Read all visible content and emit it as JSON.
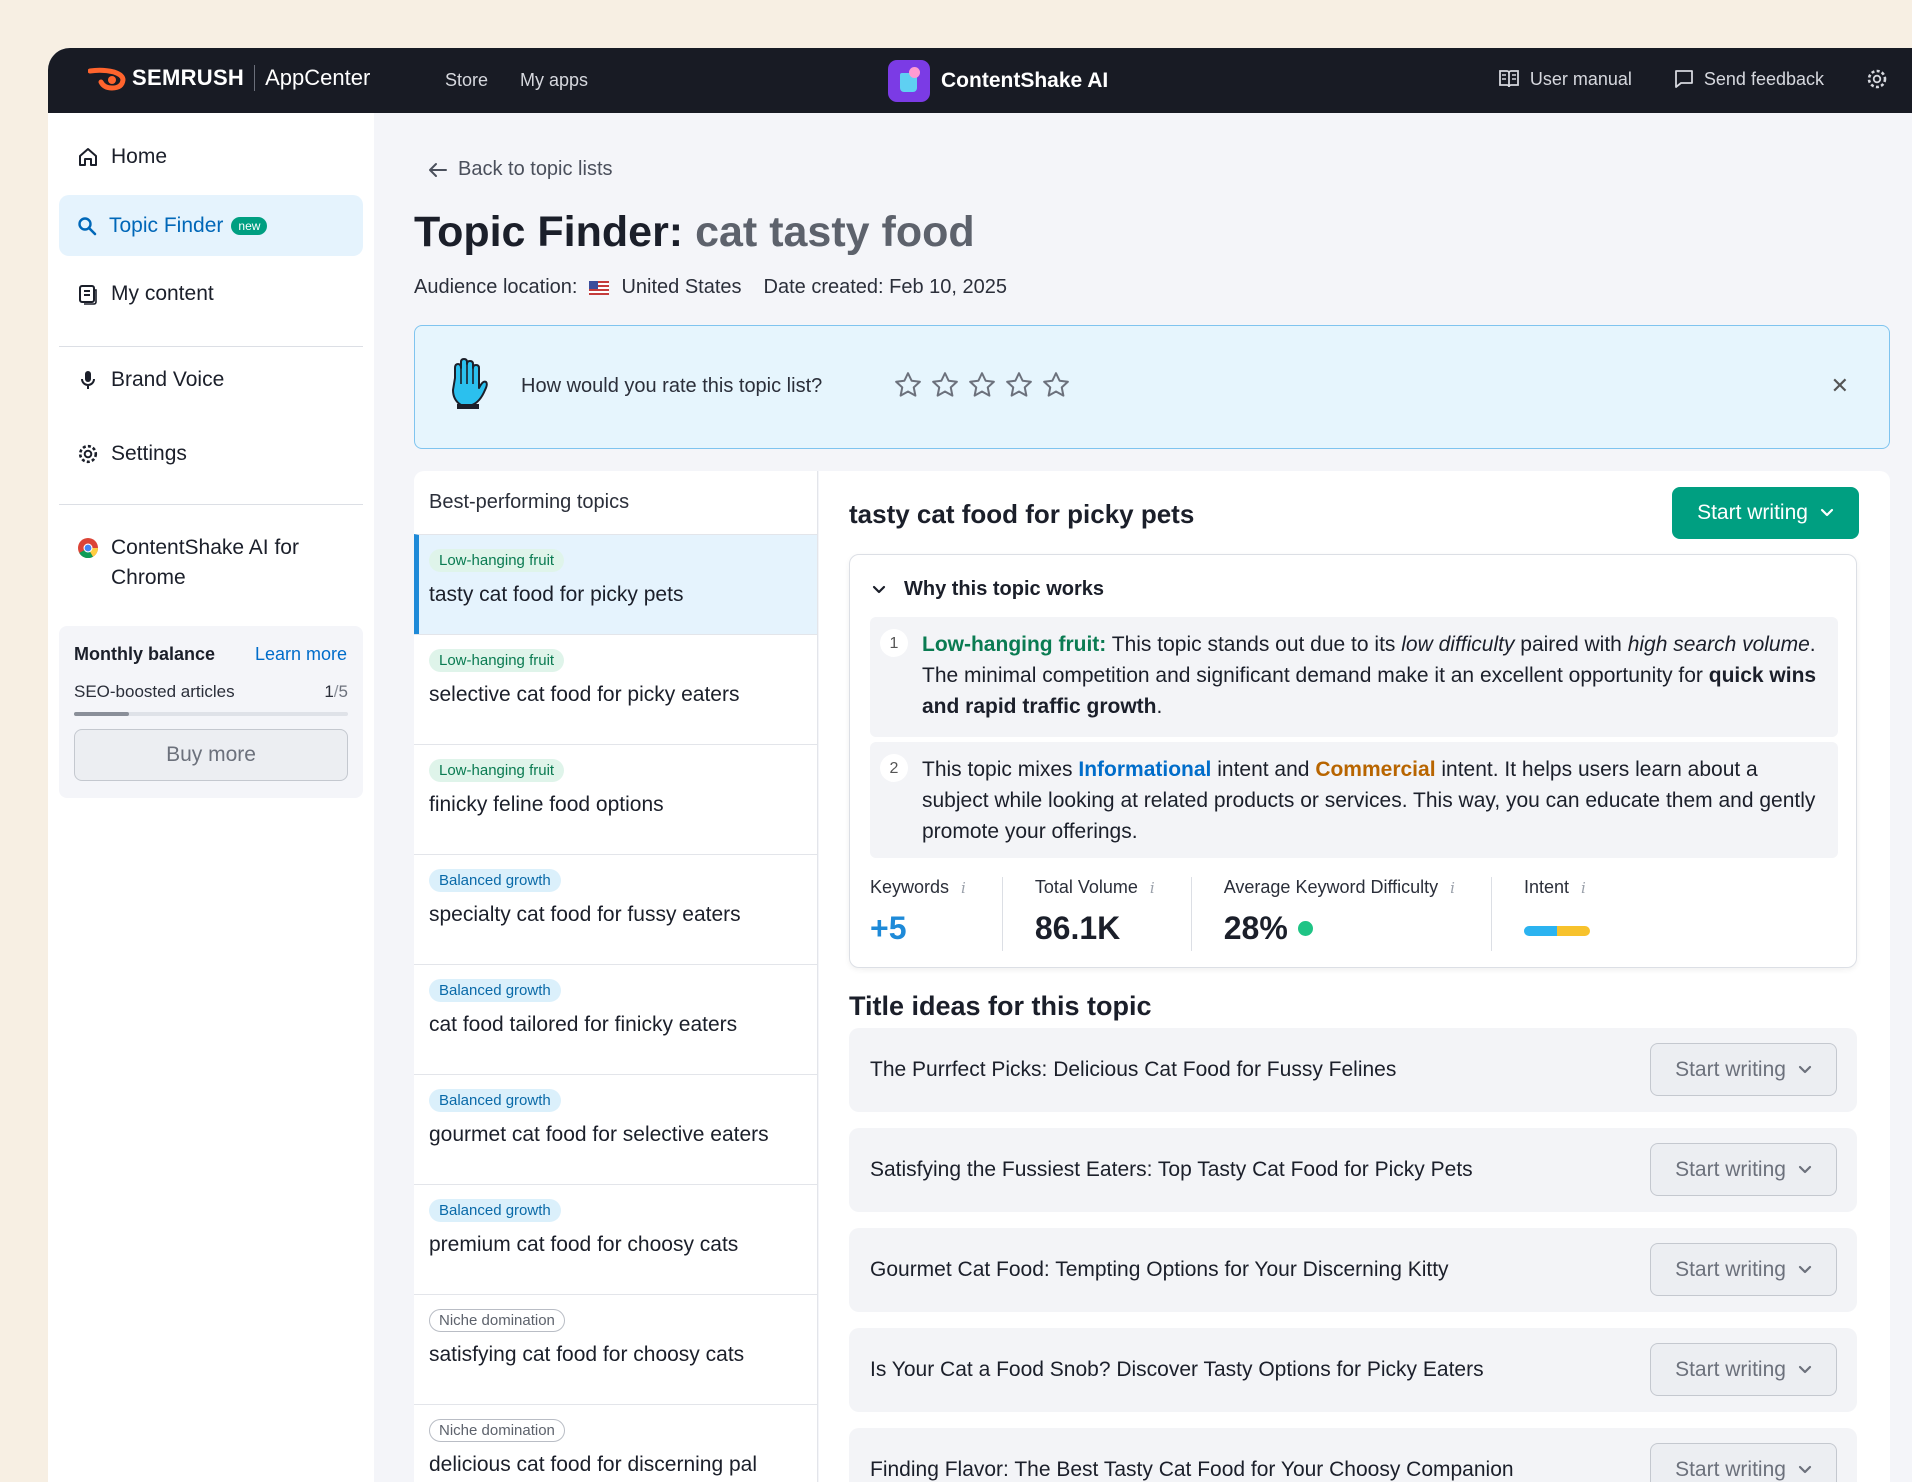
{
  "topbar": {
    "brand": "SEMRUSH",
    "appcenter": "AppCenter",
    "nav": [
      "Store",
      "My apps"
    ],
    "app_name": "ContentShake AI",
    "user_manual": "User manual",
    "send_feedback": "Send feedback"
  },
  "sidebar": {
    "home": "Home",
    "topic_finder": "Topic Finder",
    "new_badge": "new",
    "my_content": "My content",
    "brand_voice": "Brand Voice",
    "settings": "Settings",
    "chrome": "ContentShake AI for Chrome",
    "balance": {
      "title": "Monthly balance",
      "learn_more": "Learn more",
      "item": "SEO-boosted articles",
      "used": "1",
      "total": "5",
      "progress": 0.2,
      "buy_more": "Buy more"
    }
  },
  "main": {
    "back": "Back to topic lists",
    "title_prefix": "Topic Finder:",
    "title_keyword": "cat tasty food",
    "audience_label": "Audience location:",
    "audience_value": "United States",
    "date_created": "Date created: Feb 10, 2025",
    "rate_question": "How would you rate this topic list?",
    "rating": 0,
    "topics_header": "Best-performing topics",
    "topics": [
      {
        "tag": "Low-hanging fruit",
        "title": "tasty cat food for picky pets"
      },
      {
        "tag": "Low-hanging fruit",
        "title": "selective cat food for picky eaters"
      },
      {
        "tag": "Low-hanging fruit",
        "title": "finicky feline food options"
      },
      {
        "tag": "Balanced growth",
        "title": "specialty cat food for fussy eaters"
      },
      {
        "tag": "Balanced growth",
        "title": "cat food tailored for finicky eaters"
      },
      {
        "tag": "Balanced growth",
        "title": "gourmet cat food for selective eaters"
      },
      {
        "tag": "Balanced growth",
        "title": "premium cat food for choosy cats"
      },
      {
        "tag": "Niche domination",
        "title": "satisfying cat food for choosy cats"
      },
      {
        "tag": "Niche domination",
        "title": "delicious cat food for discerning pal"
      }
    ],
    "detail": {
      "title": "tasty cat food for picky pets",
      "start_writing": "Start writing",
      "why_title": "Why this topic works",
      "reason1": {
        "num": "1",
        "lead": "Low-hanging fruit:",
        "p1": " This topic stands out due to its ",
        "em1": "low difficulty",
        "p2": " paired with ",
        "em2": "high search volume",
        "p3": ". The minimal competition and significant demand make it an excellent opportunity for ",
        "strong": "quick wins and rapid traffic growth",
        "p4": "."
      },
      "reason2": {
        "num": "2",
        "p1": "This topic mixes ",
        "informational": "Informational",
        "p2": " intent and ",
        "commercial": "Commercial",
        "p3": " intent. It helps users learn about a subject while looking at related products or services. This way, you can educate them and gently promote your offerings."
      },
      "stats": {
        "keywords_label": "Keywords",
        "keywords_value": "+5",
        "volume_label": "Total Volume",
        "volume_value": "86.1K",
        "difficulty_label": "Average Keyword Difficulty",
        "difficulty_value": "28%",
        "intent_label": "Intent",
        "intent_colors": [
          "#2bb3f0",
          "#f7c22c"
        ]
      },
      "ideas_title": "Title ideas for this topic",
      "ideas": [
        "The Purrfect Picks: Delicious Cat Food for Fussy Felines",
        "Satisfying the Fussiest Eaters: Top Tasty Cat Food for Picky Pets",
        "Gourmet Cat Food: Tempting Options for Your Discerning Kitty",
        "Is Your Cat a Food Snob? Discover Tasty Options for Picky Eaters",
        "Finding Flavor: The Best Tasty Cat Food for Your Choosy Companion"
      ],
      "idea_button": "Start writing"
    }
  },
  "colors": {
    "accent_green": "#009f81",
    "accent_blue": "#006dca",
    "brand_orange": "#ff642d"
  }
}
